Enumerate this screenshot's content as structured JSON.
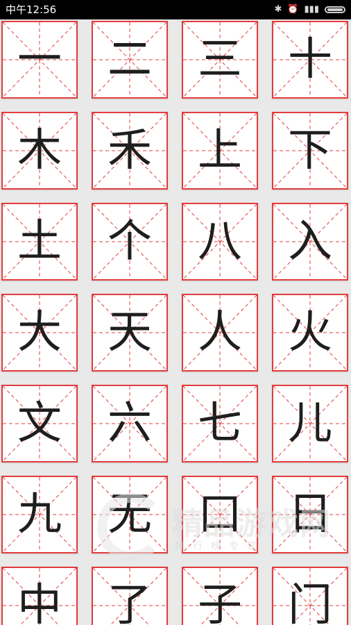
{
  "status_bar": {
    "time": "中午12:56",
    "icons": [
      "bluetooth-icon",
      "alarm-icon",
      "signal-icon",
      "battery-icon"
    ]
  },
  "characters": [
    "一",
    "二",
    "三",
    "十",
    "木",
    "禾",
    "上",
    "下",
    "土",
    "个",
    "八",
    "入",
    "大",
    "天",
    "人",
    "火",
    "文",
    "六",
    "七",
    "儿",
    "九",
    "无",
    "口",
    "日",
    "中",
    "了",
    "子",
    "门"
  ],
  "colors": {
    "grid_red": "#e23c3c",
    "char_color": "#1e1e1e",
    "background": "#e9e9e9"
  },
  "watermark": {
    "title": "精品游戏网",
    "subtitle": "排行榜专家"
  }
}
